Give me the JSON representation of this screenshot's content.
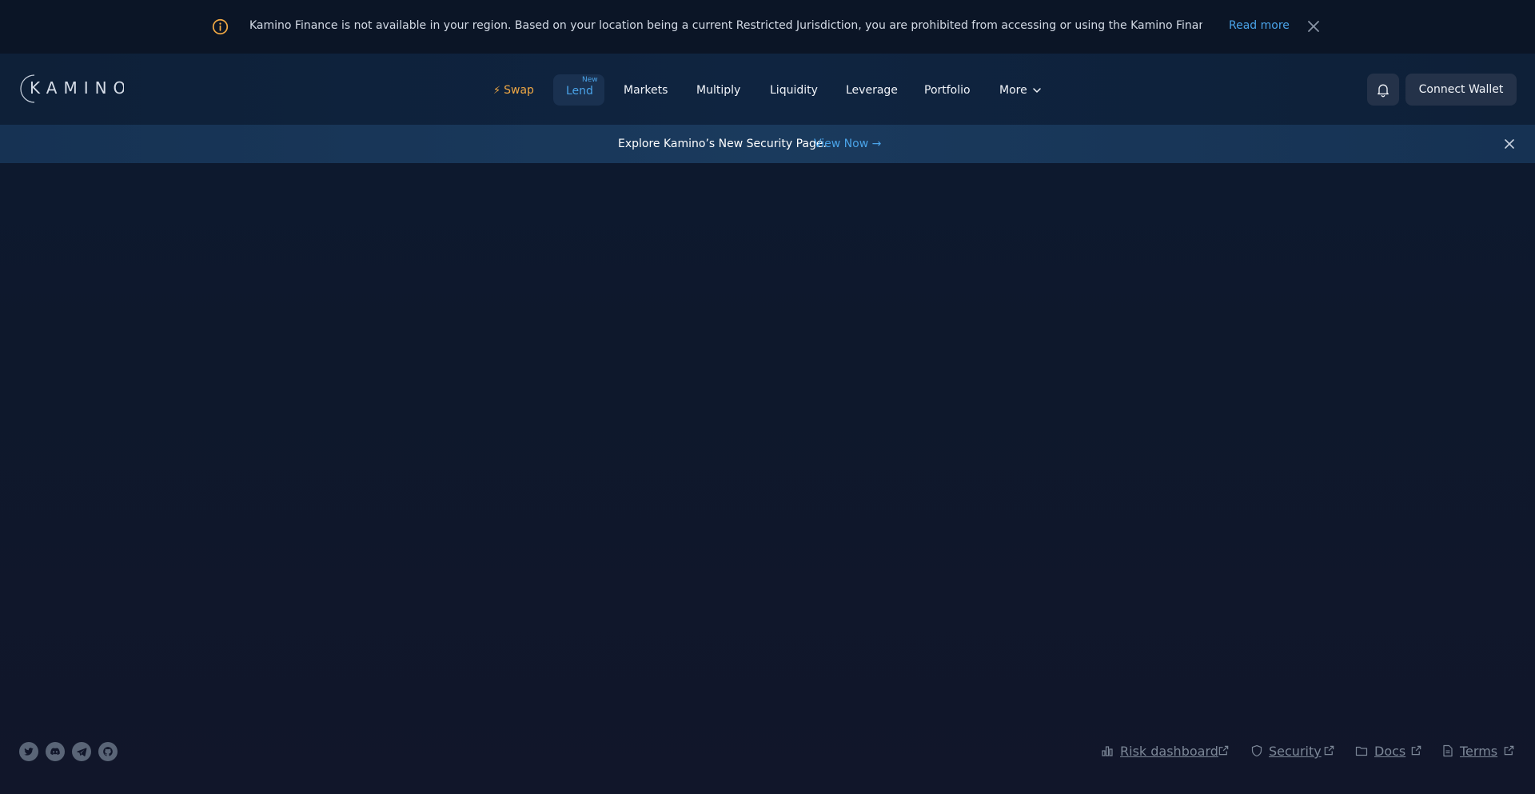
{
  "region_banner": {
    "icon": "info-circle-icon",
    "message": "Kamino Finance is not available in your region. Based on your location being a current Restricted Jurisdiction, you are prohibited from accessing or using the Kamino Finance app, platfor...",
    "read_more": "Read more",
    "close_icon": "close-icon",
    "accent_color": "#f0a844",
    "link_color": "#4aa3e8"
  },
  "header": {
    "logo_text": "KAMINO",
    "nav": {
      "swap": "Swap",
      "lend": "Lend",
      "lend_badge": "New",
      "markets": "Markets",
      "multiply": "Multiply",
      "liquidity": "Liquidity",
      "leverage": "Leverage",
      "portfolio": "Portfolio",
      "more": "More"
    },
    "notifications_icon": "bell-icon",
    "connect_wallet": "Connect Wallet"
  },
  "security_bar": {
    "text": "Explore Kamino’s New Security Page.",
    "link": "View Now →",
    "close_icon": "close-icon"
  },
  "footer": {
    "social": [
      "twitter-icon",
      "discord-icon",
      "telegram-icon",
      "github-icon"
    ],
    "links": {
      "risk": "Risk dashboard",
      "security": "Security",
      "docs": "Docs",
      "terms": "Terms"
    }
  }
}
